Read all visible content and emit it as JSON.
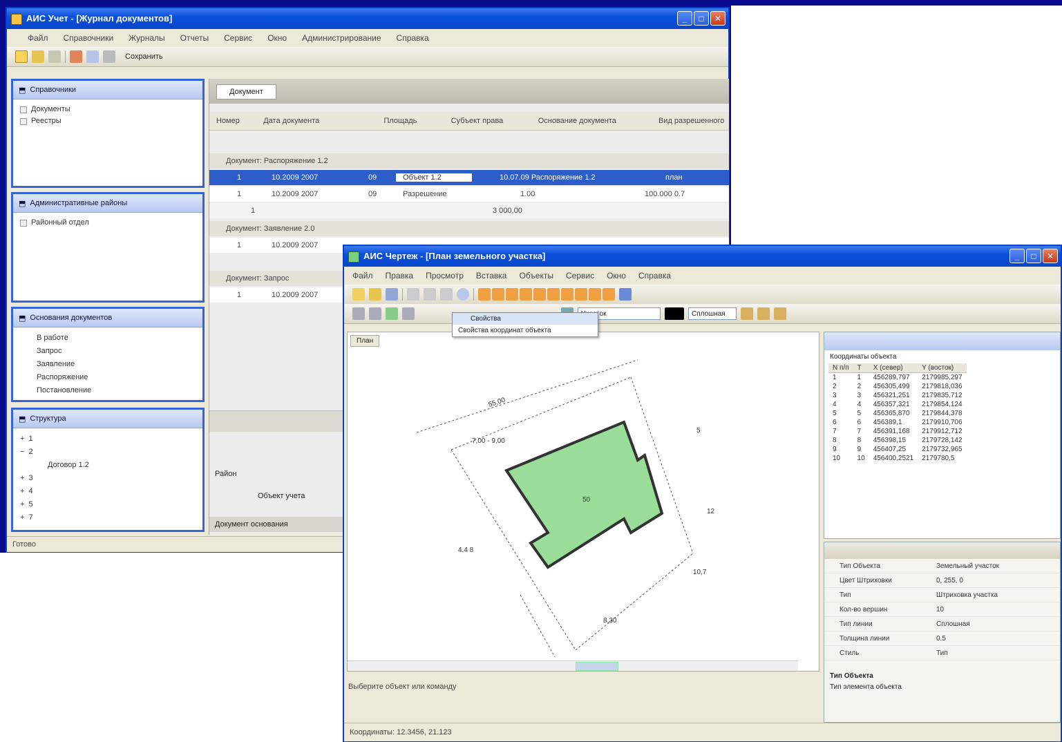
{
  "back_window": {
    "title": "АИС Учет - [Журнал документов]",
    "menu": [
      "Файл",
      "Справочники",
      "Журналы",
      "Отчеты",
      "Сервис",
      "Окно",
      "Администрирование",
      "Справка"
    ],
    "toolbar_label": "Сохранить",
    "panels": [
      {
        "title": "Справочники",
        "items": [
          "Документы",
          "Реестры"
        ]
      },
      {
        "title": "Административные районы",
        "items": [
          "Районный отдел"
        ]
      },
      {
        "title": "Основания документов",
        "items": [
          "В работе",
          "Запрос",
          "Заявление",
          "Распоряжение",
          "Постановление"
        ]
      },
      {
        "title": "Структура",
        "items": [
          "1",
          "2",
          "Договор 1.2",
          "3",
          "4",
          "5",
          "7"
        ]
      }
    ],
    "tab": "Документ",
    "grid_headers": [
      "Номер",
      "Дата документа",
      "Площадь",
      "Субъект права",
      "Основание документа",
      "Вид разрешенного"
    ],
    "groups": [
      {
        "label": "Документ: Распоряжение 1.2",
        "row": [
          "1",
          "10.2009 2007",
          "09",
          "Объект 1.2",
          "10.07.09 Распоряжение 1.2",
          "план"
        ],
        "sub": [
          "1",
          "10.2009 2007",
          "09",
          "Разрешение",
          "1.00",
          "100.000 0.7"
        ],
        "total": "3 000,00"
      },
      {
        "label": "Документ: Заявление 2.0",
        "row": [
          "1",
          "10.2009 2007"
        ]
      },
      {
        "label": "Документ: Запрос",
        "row": [
          "1",
          "10.2009 2007"
        ]
      }
    ],
    "footer_field": "Район",
    "footer_value": "Объект учета",
    "bottom_bar": "Документ основания",
    "status": "Готово"
  },
  "front_window": {
    "title": "АИС Чертеж - [План земельного участка]",
    "menu": [
      "Файл",
      "Правка",
      "Просмотр",
      "Вставка",
      "Объекты",
      "Сервис",
      "Окно",
      "Справка"
    ],
    "layer_dropdown": "Участок",
    "linetype_dropdown": "Сплошная",
    "context_menu": [
      "Свойства",
      "Свойства координат объекта"
    ],
    "canvas_tab": "План",
    "drawing_labels": {
      "parcel_id": "50",
      "top_dim": "55,00",
      "left_dim": "7,00 - 9,00",
      "side_left": "4,4 8",
      "side_right": "10,7",
      "bottom_dim": "8,30",
      "right_dim_1": "5",
      "right_dim_2": "12"
    },
    "coords_panel": {
      "title": "Координаты объекта",
      "headers": [
        "N п/п",
        "Т",
        "Х (север)",
        "Y (восток)"
      ],
      "rows": [
        [
          "1",
          "1",
          "456289,797",
          "2179985,297"
        ],
        [
          "2",
          "2",
          "456305,499",
          "2179818,036"
        ],
        [
          "3",
          "3",
          "456321,251",
          "2179835,712"
        ],
        [
          "4",
          "4",
          "456357,321",
          "2179854,124"
        ],
        [
          "5",
          "5",
          "456365,870",
          "2179844,378"
        ],
        [
          "6",
          "6",
          "456389,1",
          "2179910,706"
        ],
        [
          "7",
          "7",
          "456391,168",
          "2179912,712"
        ],
        [
          "8",
          "8",
          "456398,15",
          "2179728,142"
        ],
        [
          "9",
          "9",
          "456407,25",
          "2179732,965"
        ],
        [
          "10",
          "10",
          "456400,2521",
          "2179780,5"
        ]
      ]
    },
    "props_panel": {
      "rows": [
        [
          "Тип Объекта",
          "Земельный участок"
        ],
        [
          "Цвет Штриховки",
          "0, 255, 0"
        ],
        [
          "Тип",
          "Штриховка участка"
        ],
        [
          "Кол-во вершин",
          "10"
        ],
        [
          "Тип линии",
          "Сплошная"
        ],
        [
          "Толщина линии",
          "0.5"
        ],
        [
          "Стиль",
          "Тип"
        ]
      ],
      "footer_title": "Тип Объекта",
      "footer_desc": "Тип элемента объекта"
    },
    "hint": "Выберите объект или команду",
    "status": "Координаты: 12.3456, 21.123"
  },
  "colors": {
    "parcel_fill": "#99dd99",
    "selection": "#2d5dc8"
  }
}
